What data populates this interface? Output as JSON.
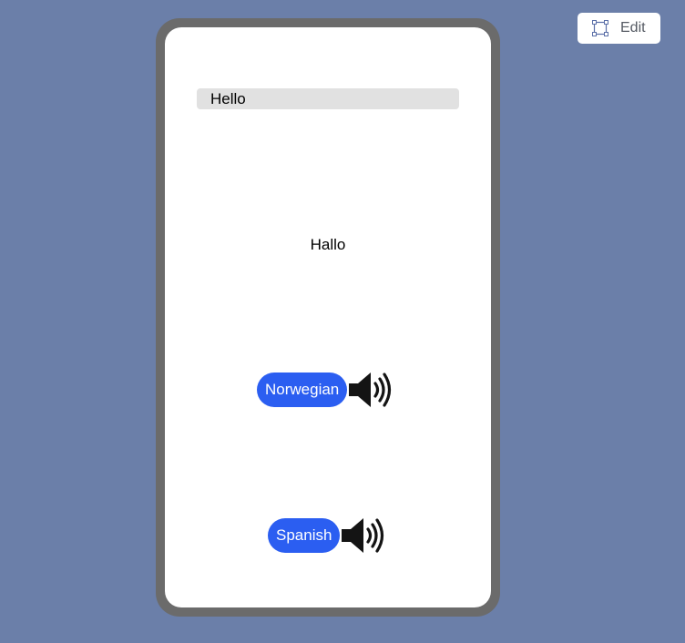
{
  "toolbar": {
    "edit_label": "Edit"
  },
  "input": {
    "value": "Hello"
  },
  "translation": {
    "text": "Hallo"
  },
  "languages": [
    {
      "label": "Norwegian",
      "icon": "speaker-icon"
    },
    {
      "label": "Spanish",
      "icon": "speaker-icon"
    }
  ],
  "colors": {
    "background": "#6b7fa9",
    "phone_frame": "#6b6b6b",
    "button_accent": "#2b5ef1",
    "input_bg": "#e1e1e1"
  }
}
